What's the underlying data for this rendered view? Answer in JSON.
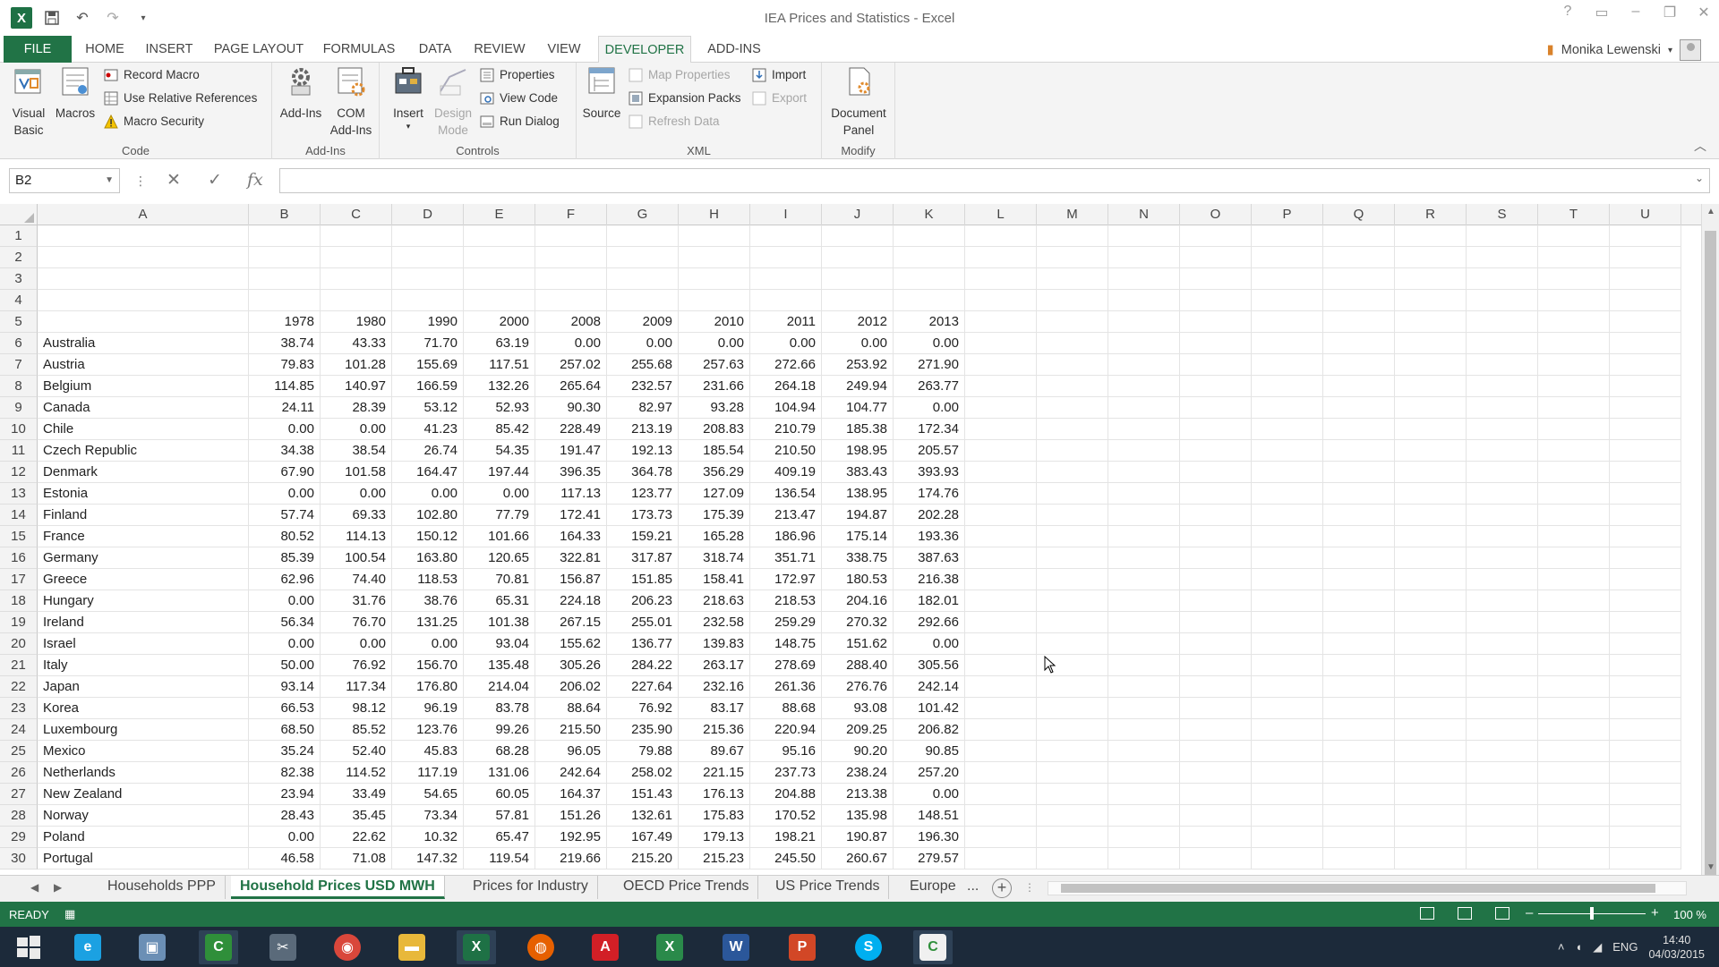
{
  "window": {
    "title": "IEA Prices and Statistics - Excel",
    "user": "Monika Lewenski"
  },
  "tabs": [
    "FILE",
    "HOME",
    "INSERT",
    "PAGE LAYOUT",
    "FORMULAS",
    "DATA",
    "REVIEW",
    "VIEW",
    "DEVELOPER",
    "ADD-INS"
  ],
  "ribbon": {
    "code": {
      "label": "Code",
      "visual_basic": "Visual Basic",
      "macros": "Macros",
      "record_macro": "Record Macro",
      "use_relative": "Use Relative References",
      "macro_security": "Macro Security"
    },
    "addins": {
      "label": "Add-Ins",
      "addins_btn": "Add-Ins",
      "com_addins": "COM Add-Ins"
    },
    "controls": {
      "label": "Controls",
      "insert": "Insert",
      "design_mode": "Design Mode",
      "properties": "Properties",
      "view_code": "View Code",
      "run_dialog": "Run Dialog"
    },
    "xml": {
      "label": "XML",
      "source": "Source",
      "map_properties": "Map Properties",
      "expansion_packs": "Expansion Packs",
      "refresh_data": "Refresh Data",
      "import": "Import",
      "export": "Export"
    },
    "modify": {
      "label": "Modify",
      "document_panel": "Document Panel"
    }
  },
  "formula_bar": {
    "name_box": "B2",
    "formula": ""
  },
  "columns": [
    "A",
    "B",
    "C",
    "D",
    "E",
    "F",
    "G",
    "H",
    "I",
    "J",
    "K",
    "L",
    "M",
    "N",
    "O",
    "P",
    "Q",
    "R",
    "S",
    "T",
    "U"
  ],
  "years": [
    "1978",
    "1980",
    "1990",
    "2000",
    "2008",
    "2009",
    "2010",
    "2011",
    "2012",
    "2013"
  ],
  "countries": [
    {
      "name": "Australia",
      "v": [
        "38.74",
        "43.33",
        "71.70",
        "63.19",
        "0.00",
        "0.00",
        "0.00",
        "0.00",
        "0.00",
        "0.00"
      ]
    },
    {
      "name": "Austria",
      "v": [
        "79.83",
        "101.28",
        "155.69",
        "117.51",
        "257.02",
        "255.68",
        "257.63",
        "272.66",
        "253.92",
        "271.90"
      ]
    },
    {
      "name": "Belgium",
      "v": [
        "114.85",
        "140.97",
        "166.59",
        "132.26",
        "265.64",
        "232.57",
        "231.66",
        "264.18",
        "249.94",
        "263.77"
      ]
    },
    {
      "name": "Canada",
      "v": [
        "24.11",
        "28.39",
        "53.12",
        "52.93",
        "90.30",
        "82.97",
        "93.28",
        "104.94",
        "104.77",
        "0.00"
      ]
    },
    {
      "name": "Chile",
      "v": [
        "0.00",
        "0.00",
        "41.23",
        "85.42",
        "228.49",
        "213.19",
        "208.83",
        "210.79",
        "185.38",
        "172.34"
      ]
    },
    {
      "name": "Czech Republic",
      "v": [
        "34.38",
        "38.54",
        "26.74",
        "54.35",
        "191.47",
        "192.13",
        "185.54",
        "210.50",
        "198.95",
        "205.57"
      ]
    },
    {
      "name": "Denmark",
      "v": [
        "67.90",
        "101.58",
        "164.47",
        "197.44",
        "396.35",
        "364.78",
        "356.29",
        "409.19",
        "383.43",
        "393.93"
      ]
    },
    {
      "name": "Estonia",
      "v": [
        "0.00",
        "0.00",
        "0.00",
        "0.00",
        "117.13",
        "123.77",
        "127.09",
        "136.54",
        "138.95",
        "174.76"
      ]
    },
    {
      "name": "Finland",
      "v": [
        "57.74",
        "69.33",
        "102.80",
        "77.79",
        "172.41",
        "173.73",
        "175.39",
        "213.47",
        "194.87",
        "202.28"
      ]
    },
    {
      "name": "France",
      "v": [
        "80.52",
        "114.13",
        "150.12",
        "101.66",
        "164.33",
        "159.21",
        "165.28",
        "186.96",
        "175.14",
        "193.36"
      ]
    },
    {
      "name": "Germany",
      "v": [
        "85.39",
        "100.54",
        "163.80",
        "120.65",
        "322.81",
        "317.87",
        "318.74",
        "351.71",
        "338.75",
        "387.63"
      ]
    },
    {
      "name": "Greece",
      "v": [
        "62.96",
        "74.40",
        "118.53",
        "70.81",
        "156.87",
        "151.85",
        "158.41",
        "172.97",
        "180.53",
        "216.38"
      ]
    },
    {
      "name": "Hungary",
      "v": [
        "0.00",
        "31.76",
        "38.76",
        "65.31",
        "224.18",
        "206.23",
        "218.63",
        "218.53",
        "204.16",
        "182.01"
      ]
    },
    {
      "name": "Ireland",
      "v": [
        "56.34",
        "76.70",
        "131.25",
        "101.38",
        "267.15",
        "255.01",
        "232.58",
        "259.29",
        "270.32",
        "292.66"
      ]
    },
    {
      "name": "Israel",
      "v": [
        "0.00",
        "0.00",
        "0.00",
        "93.04",
        "155.62",
        "136.77",
        "139.83",
        "148.75",
        "151.62",
        "0.00"
      ]
    },
    {
      "name": "Italy",
      "v": [
        "50.00",
        "76.92",
        "156.70",
        "135.48",
        "305.26",
        "284.22",
        "263.17",
        "278.69",
        "288.40",
        "305.56"
      ]
    },
    {
      "name": "Japan",
      "v": [
        "93.14",
        "117.34",
        "176.80",
        "214.04",
        "206.02",
        "227.64",
        "232.16",
        "261.36",
        "276.76",
        "242.14"
      ]
    },
    {
      "name": "Korea",
      "v": [
        "66.53",
        "98.12",
        "96.19",
        "83.78",
        "88.64",
        "76.92",
        "83.17",
        "88.68",
        "93.08",
        "101.42"
      ]
    },
    {
      "name": "Luxembourg",
      "v": [
        "68.50",
        "85.52",
        "123.76",
        "99.26",
        "215.50",
        "235.90",
        "215.36",
        "220.94",
        "209.25",
        "206.82"
      ]
    },
    {
      "name": "Mexico",
      "v": [
        "35.24",
        "52.40",
        "45.83",
        "68.28",
        "96.05",
        "79.88",
        "89.67",
        "95.16",
        "90.20",
        "90.85"
      ]
    },
    {
      "name": "Netherlands",
      "v": [
        "82.38",
        "114.52",
        "117.19",
        "131.06",
        "242.64",
        "258.02",
        "221.15",
        "237.73",
        "238.24",
        "257.20"
      ]
    },
    {
      "name": "New Zealand",
      "v": [
        "23.94",
        "33.49",
        "54.65",
        "60.05",
        "164.37",
        "151.43",
        "176.13",
        "204.88",
        "213.38",
        "0.00"
      ]
    },
    {
      "name": "Norway",
      "v": [
        "28.43",
        "35.45",
        "73.34",
        "57.81",
        "151.26",
        "132.61",
        "175.83",
        "170.52",
        "135.98",
        "148.51"
      ]
    },
    {
      "name": "Poland",
      "v": [
        "0.00",
        "22.62",
        "10.32",
        "65.47",
        "192.95",
        "167.49",
        "179.13",
        "198.21",
        "190.87",
        "196.30"
      ]
    },
    {
      "name": "Portugal",
      "v": [
        "46.58",
        "71.08",
        "147.32",
        "119.54",
        "219.66",
        "215.20",
        "215.23",
        "245.50",
        "260.67",
        "279.57"
      ]
    }
  ],
  "sheets": [
    "Households PPP",
    "Household  Prices USD MWH",
    "Prices for Industry",
    "OECD Price Trends",
    "US Price Trends",
    "Europe",
    "..."
  ],
  "status": {
    "ready": "READY",
    "zoom": "100 %"
  },
  "taskbar": {
    "lang": "ENG",
    "time": "14:40",
    "date": "04/03/2015"
  },
  "colors": {
    "excel_green": "#217346",
    "taskbar": "#1c2a3a"
  }
}
